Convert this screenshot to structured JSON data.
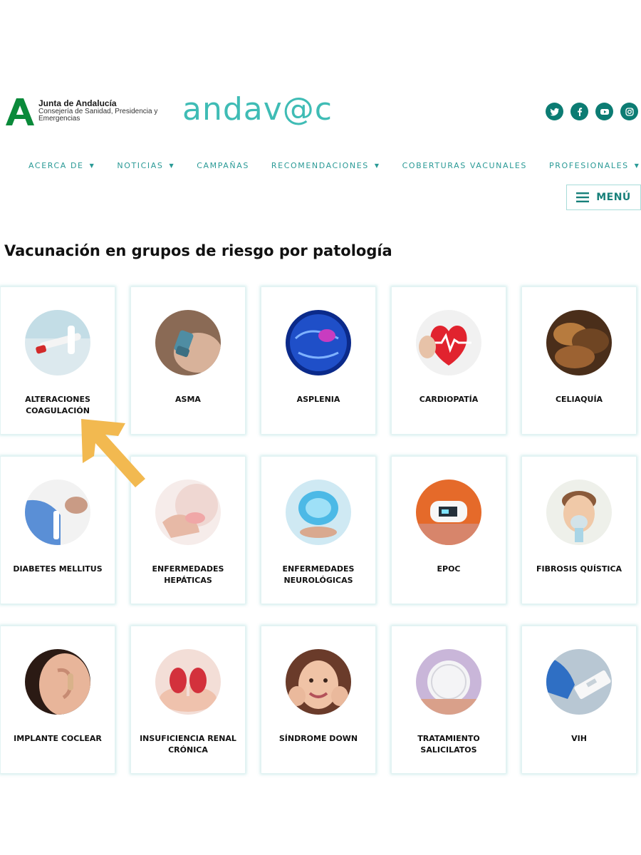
{
  "header": {
    "junta_title": "Junta de Andalucía",
    "junta_subtitle": "Consejería de Sanidad, Presidencia y Emergencias",
    "brand": "andav@c",
    "social": [
      {
        "name": "twitter-icon"
      },
      {
        "name": "facebook-icon"
      },
      {
        "name": "youtube-icon"
      },
      {
        "name": "instagram-icon"
      }
    ],
    "colors": {
      "accent": "#3fbcb5",
      "dark_teal": "#0c7c73",
      "nav": "#2a9a96",
      "junta_green": "#0a8a3a"
    }
  },
  "nav": {
    "items": [
      {
        "label": "ACERCA DE",
        "dropdown": true
      },
      {
        "label": "NOTICIAS",
        "dropdown": true
      },
      {
        "label": "CAMPAÑAS",
        "dropdown": false
      },
      {
        "label": "RECOMENDACIONES",
        "dropdown": true
      },
      {
        "label": "COBERTURAS VACUNALES",
        "dropdown": false
      },
      {
        "label": "PROFESIONALES",
        "dropdown": true
      }
    ],
    "menu_label": "MENÚ"
  },
  "main": {
    "title": "Vacunación en grupos de riesgo por patología",
    "cards": [
      {
        "label": "ALTERACIONES COAGULACIÓN",
        "icon": "blood-sample-icon"
      },
      {
        "label": "ASMA",
        "icon": "inhaler-icon"
      },
      {
        "label": "ASPLENIA",
        "icon": "spleen-icon"
      },
      {
        "label": "CARDIOPATÍA",
        "icon": "heart-icon"
      },
      {
        "label": "CELIAQUÍA",
        "icon": "bread-icon"
      },
      {
        "label": "DIABETES MELLITUS",
        "icon": "glucose-test-icon"
      },
      {
        "label": "ENFERMEDADES HEPÁTICAS",
        "icon": "liver-icon"
      },
      {
        "label": "ENFERMEDADES NEUROLÓGICAS",
        "icon": "brain-icon"
      },
      {
        "label": "EPOC",
        "icon": "pulse-oximeter-icon"
      },
      {
        "label": "FIBROSIS QUÍSTICA",
        "icon": "nebulizer-icon"
      },
      {
        "label": "IMPLANTE COCLEAR",
        "icon": "ear-icon"
      },
      {
        "label": "INSUFICIENCIA RENAL CRÓNICA",
        "icon": "kidney-icon"
      },
      {
        "label": "SÍNDROME DOWN",
        "icon": "child-icon"
      },
      {
        "label": "TRATAMIENTO SALICILATOS",
        "icon": "aspirin-icon"
      },
      {
        "label": "VIH",
        "icon": "hiv-test-icon"
      }
    ]
  },
  "annotation": {
    "icon": "arrow-icon",
    "color": "#f2b950"
  }
}
